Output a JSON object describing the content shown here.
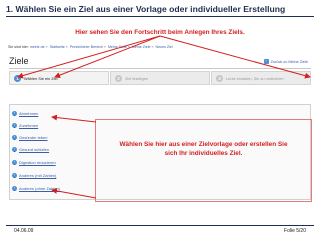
{
  "slide": {
    "title": "1. Wählen Sie ein Ziel aus einer Vorlage oder individueller Erstellung",
    "callout_top": "Hier sehen Sie den Fortschritt beim Anlegen Ihres Ziels.",
    "callout_mid_line1": "Wählen Sie hier aus einer Zielvorlage oder erstellen Sie",
    "callout_mid_line2": "sich Ihr individuelles Ziel.",
    "footer_date": "04.06.09",
    "footer_page": "Folie 5/20"
  },
  "breadcrumb": {
    "label": "Sie sind hier:",
    "items": [
      "meetz.de",
      "Startseite",
      "Persönlicher Bereich",
      "Meine Seite",
      "Meine Ziele",
      "Neues Ziel"
    ]
  },
  "screen": {
    "title": "Ziele",
    "back_link": "Zurück zu Meine Ziele",
    "back_icon": "arrow-left-icon"
  },
  "steps": [
    {
      "num": "1",
      "label": "Wählen Sie ein Ziel",
      "active": true
    },
    {
      "num": "2",
      "label": "Ziel festlegen",
      "active": false
    },
    {
      "num": "3",
      "label": "Leute einladen, Sie zu motivieren",
      "active": false
    }
  ],
  "goal_templates": [
    "Abnehmen",
    "Zunehmen",
    "Gesünder leben",
    "Gesund schlafen",
    "Digestion reduzieren",
    "Anderes (mit Zahlen)",
    "Anderes (ohne Zahlen)"
  ],
  "colors": {
    "accent_red": "#d32020",
    "link_blue": "#3a5ea8",
    "step_active": "#4a90d9"
  }
}
